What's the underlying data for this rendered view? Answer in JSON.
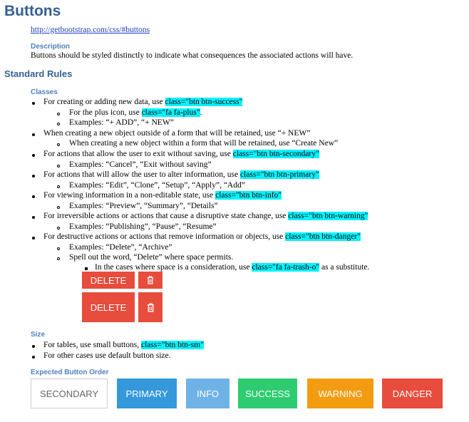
{
  "title": "Buttons",
  "link": "http://getbootstrap.com/css/#buttons",
  "description": {
    "label": "Description",
    "text": "Buttons should be styled distinctly to indicate what consequences the associated actions will have."
  },
  "standard_rules": {
    "heading": "Standard Rules",
    "classes_label": "Classes",
    "r1": {
      "pre": "For creating or adding new data, use ",
      "code": "class=\"btn btn-success\""
    },
    "r1a": {
      "pre": "For the plus icon, use ",
      "code": "class=\"fa fa-plus\"",
      "post": "."
    },
    "r1b": "Examples: “+ ADD”, “+ NEW”",
    "r2": "When creating a new object outside of a form that will be retained, use “+ NEW”",
    "r2a": "When creating a new object within a form that will be retained, use “Create New”",
    "r3": {
      "pre": "For actions that allow the user to exit without saving, use ",
      "code": "class=\"btn btn-secondary\""
    },
    "r3a": "Examples: “Cancel”, “Exit without saving”",
    "r4": {
      "pre": "For actions that will allow the user to alter information, use ",
      "code": "class=\"btn btn-primary\""
    },
    "r4a": "Examples: “Edit”, “Clone”, “Setup”, “Apply”, “Add”",
    "r5": {
      "pre": "For viewing information in a non-editable state, use ",
      "code": "class=\"btn btn-info\""
    },
    "r5a": "Examples: “Preview”, “Summary”, “Details”",
    "r6": {
      "pre": "For irreversible actions or actions that cause a disruptive state change, use ",
      "code": "class=\"btn btn-warning\""
    },
    "r6a": "Examples: “Publishing”, “Pause”, “Resume”",
    "r7": {
      "pre": "For destructive actions or actions that remove information or objects, use ",
      "code": "class=\"btn btn-danger\""
    },
    "r7a": "Examples: “Delete”, “Archive”",
    "r7b": "Spell out the word, “Delete” where space permits.",
    "r7c": {
      "pre": "In the cases where space is a consideration, use ",
      "code": "class=\"fa fa-trash-o\"",
      "post": " as a substitute."
    },
    "delete_small": "DELETE",
    "delete_default": "DELETE"
  },
  "size": {
    "label": "Size",
    "s1": {
      "pre": "For tables, use small buttons, ",
      "code": "class=\"btn btn-sm\""
    },
    "s2": "For other cases use default button size."
  },
  "order": {
    "label": "Expected Button Order",
    "buttons": [
      "SECONDARY",
      "PRIMARY",
      "INFO",
      "SUCCESS",
      "WARNING",
      "DANGER"
    ]
  },
  "colors": {
    "secondary": "#ffffff",
    "primary": "#3498db",
    "info": "#6fb3e6",
    "success": "#2ecc71",
    "warning": "#f39c12",
    "danger": "#e74c3c",
    "highlight": "#00f3ff"
  },
  "icons": {
    "trash": "trash-icon"
  }
}
